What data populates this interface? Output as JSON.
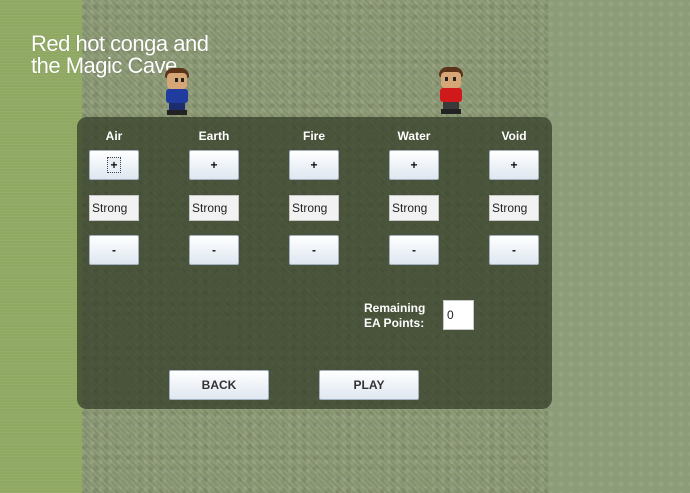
{
  "game": {
    "title_line1": "Red hot conga and",
    "title_line2": "the Magic Cave"
  },
  "characters": [
    {
      "name": "blue-character",
      "shirt_color": "#1f3c9e"
    },
    {
      "name": "red-character",
      "shirt_color": "#d0191b"
    }
  ],
  "elements": [
    {
      "label": "Air",
      "plus": "+",
      "value": "Strong",
      "minus": "-"
    },
    {
      "label": "Earth",
      "plus": "+",
      "value": "Strong",
      "minus": "-"
    },
    {
      "label": "Fire",
      "plus": "+",
      "value": "Strong",
      "minus": "-"
    },
    {
      "label": "Water",
      "plus": "+",
      "value": "Strong",
      "minus": "-"
    },
    {
      "label": "Void",
      "plus": "+",
      "value": "Strong",
      "minus": "-"
    }
  ],
  "remaining": {
    "label_line1": "Remaining",
    "label_line2": "EA Points:",
    "value": "0"
  },
  "buttons": {
    "back": "BACK",
    "play": "PLAY"
  }
}
